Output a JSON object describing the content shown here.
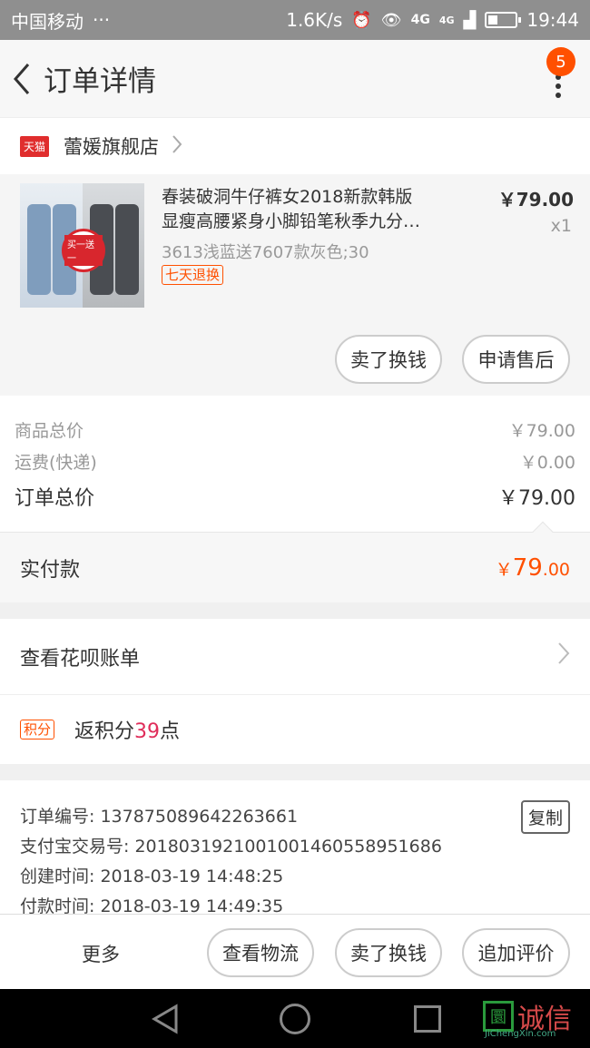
{
  "status_bar": {
    "carrier": "中国移动",
    "dots": "···",
    "speed": "1.6K/s",
    "net1": "4G",
    "net2": "4G",
    "time": "19:44",
    "battery_level": 0.35
  },
  "header": {
    "title": "订单详情",
    "badge": "5"
  },
  "shop": {
    "tag": "天猫",
    "name": "蕾媛旗舰店"
  },
  "product": {
    "name_line1": "春装破洞牛仔裤女2018新款韩版",
    "name_line2": "显瘦高腰紧身小脚铅笔秋季九分…",
    "sku": "3613浅蓝送7607款灰色;30",
    "tag": "七天退换",
    "price": "￥79.00",
    "qty": "x1",
    "image_stamp": "买一送一",
    "buttons": {
      "resell": "卖了换钱",
      "after_sale": "申请售后"
    }
  },
  "summary": {
    "goods_label": "商品总价",
    "goods_value": "￥79.00",
    "shipping_label": "运费(快递)",
    "shipping_value": "￥0.00",
    "total_label": "订单总价",
    "total_value": "￥79.00"
  },
  "paid": {
    "label": "实付款",
    "currency": "￥",
    "integer": "79",
    "decimal": ".00"
  },
  "huabei": {
    "label": "查看花呗账单"
  },
  "points": {
    "tag": "积分",
    "prefix": "返积分",
    "value": "39",
    "suffix": "点"
  },
  "order_info": {
    "order_no": "订单编号: 137875089642263661",
    "alipay_no": "支付宝交易号: 2018031921001001460558951686",
    "created": "创建时间: 2018-03-19 14:48:25",
    "paid_time": "付款时间: 2018-03-19 14:49:35",
    "copy": "复制"
  },
  "bottom": {
    "more": "更多",
    "logistics": "查看物流",
    "resell": "卖了换钱",
    "review": "追加评价"
  },
  "watermark": {
    "box": "圜",
    "text": "诚信",
    "sub": "JiChengXin.com"
  },
  "colors": {
    "accent": "#ff5000",
    "tmall_red": "#e02d2d",
    "points_red": "#e02d5a"
  }
}
